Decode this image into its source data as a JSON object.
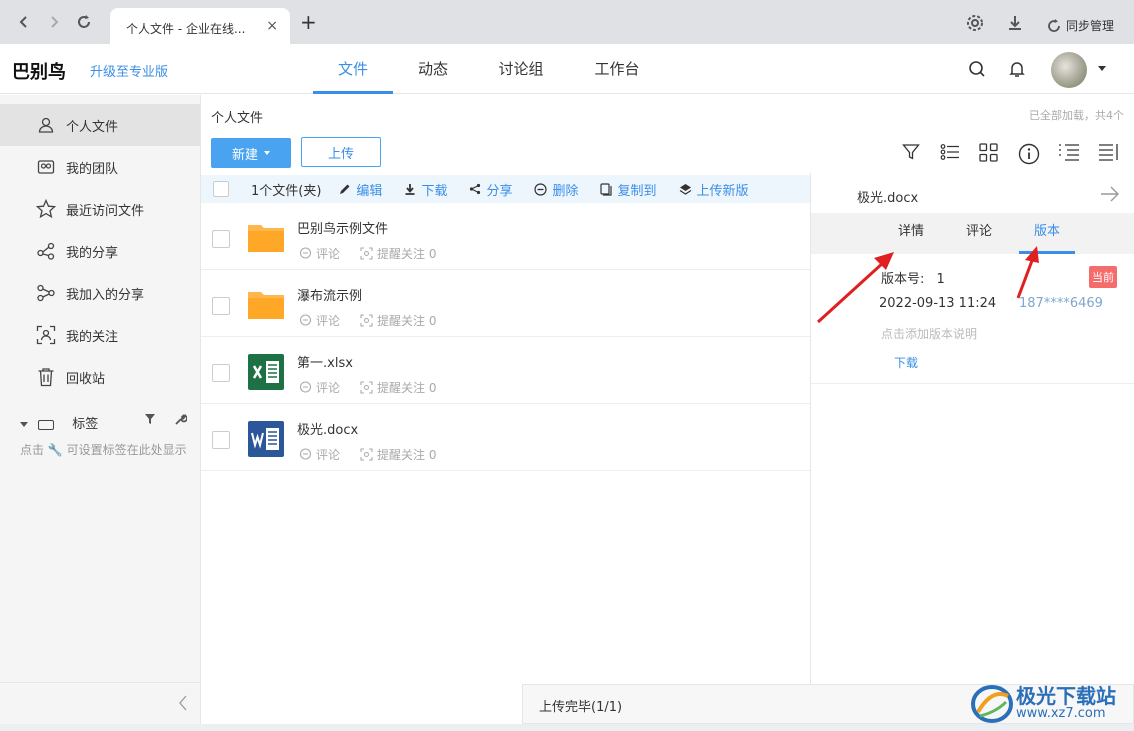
{
  "browser": {
    "tab_title": "个人文件 - 企业在线...",
    "tab_close": "×",
    "new_tab": "+",
    "sync_label": "同步管理"
  },
  "header": {
    "logo": "巴别鸟",
    "upgrade": "升级至专业版",
    "nav": [
      "文件",
      "动态",
      "讨论组",
      "工作台"
    ],
    "active_nav": "文件"
  },
  "sidebar": {
    "items": [
      {
        "label": "个人文件",
        "icon": "person-icon"
      },
      {
        "label": "我的团队",
        "icon": "team-icon"
      },
      {
        "label": "最近访问文件",
        "icon": "star-icon"
      },
      {
        "label": "我的分享",
        "icon": "share-icon"
      },
      {
        "label": "我加入的分享",
        "icon": "joined-share-icon"
      },
      {
        "label": "我的关注",
        "icon": "focus-icon"
      },
      {
        "label": "回收站",
        "icon": "trash-icon"
      }
    ],
    "tags_label": "标签",
    "tags_hint": "点击 🔧 可设置标签在此处显示"
  },
  "main": {
    "breadcrumb": "个人文件",
    "load_info": "已全部加载，共4个",
    "new_button": "新建",
    "upload_button": "上传",
    "selection_count": "1个文件(夹)",
    "actions": [
      "编辑",
      "下载",
      "分享",
      "删除",
      "复制到",
      "上传新版"
    ],
    "files": [
      {
        "name": "巴别鸟示例文件",
        "type": "folder",
        "comment": "评论",
        "remind": "提醒关注 0"
      },
      {
        "name": "瀑布流示例",
        "type": "folder",
        "comment": "评论",
        "remind": "提醒关注 0"
      },
      {
        "name": "第一.xlsx",
        "type": "excel",
        "comment": "评论",
        "remind": "提醒关注 0"
      },
      {
        "name": "极光.docx",
        "type": "word",
        "comment": "评论",
        "remind": "提醒关注 0"
      }
    ]
  },
  "panel": {
    "title": "极光.docx",
    "tabs": [
      "详情",
      "评论",
      "版本"
    ],
    "active_tab": "版本",
    "version_label": "版本号:",
    "version_number": "1",
    "current_badge": "当前",
    "version_date": "2022-09-13 11:24",
    "version_user": "187****6469",
    "add_desc": "点击添加版本说明",
    "download": "下载"
  },
  "upload_toast": "上传完毕(1/1)",
  "watermark": {
    "text": "极光下载站",
    "url": "www.xz7.com"
  },
  "colors": {
    "accent": "#3a8ee6",
    "badge": "#f56c6c",
    "folder": "#ffb74d",
    "excel": "#1e7145",
    "word": "#2b579a",
    "annotation": "#e02020"
  }
}
